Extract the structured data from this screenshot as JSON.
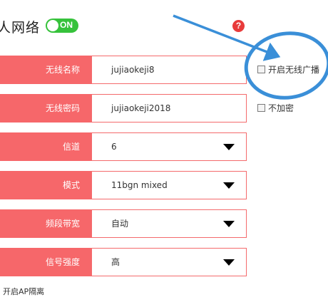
{
  "header": {
    "title": "人网络",
    "toggle_label": "ON",
    "help_icon": "?"
  },
  "form": {
    "rows": [
      {
        "label": "无线名称",
        "value": "jujiaokeji8",
        "type": "text"
      },
      {
        "label": "无线密码",
        "value": "jujiaokeji2018",
        "type": "text"
      },
      {
        "label": "信道",
        "value": "6",
        "type": "select"
      },
      {
        "label": "模式",
        "value": "11bgn mixed",
        "type": "select"
      },
      {
        "label": "频段带宽",
        "value": "自动",
        "type": "select"
      },
      {
        "label": "信号强度",
        "value": "高",
        "type": "select"
      }
    ]
  },
  "options": {
    "broadcast_label": "开启无线广播",
    "no_encrypt_label": "不加密"
  },
  "footer": {
    "text": "开启AP隔离"
  },
  "colors": {
    "label_bg": "#f6676a",
    "field_border": "#f46a6c",
    "toggle_on": "#36c23b",
    "help_icon": "#e83b3b",
    "annotation": "#3a8fd8"
  }
}
